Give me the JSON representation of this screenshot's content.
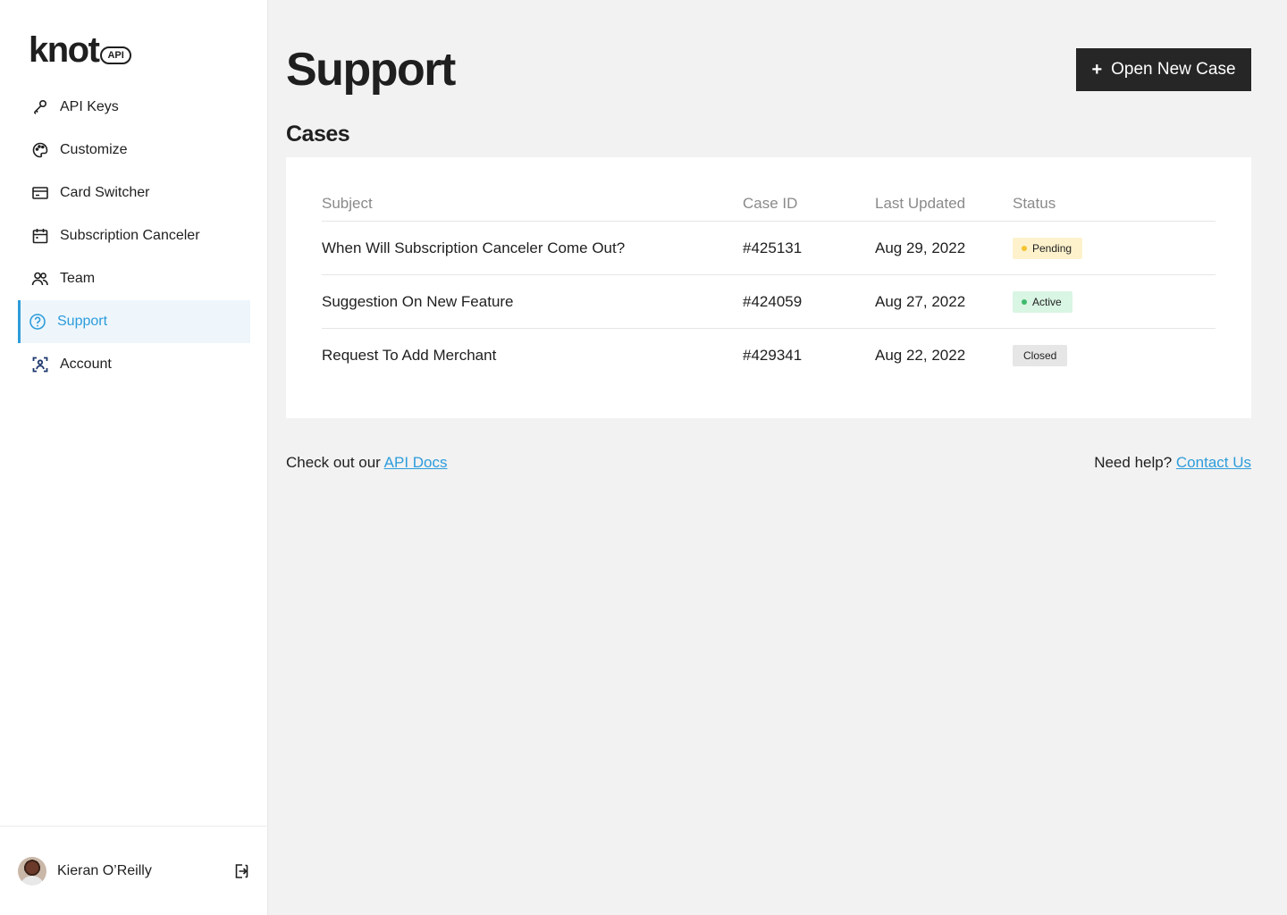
{
  "logo": {
    "word": "knot",
    "badge": "API"
  },
  "nav": [
    {
      "label": "API Keys",
      "icon": "key-icon",
      "active": false
    },
    {
      "label": "Customize",
      "icon": "palette-icon",
      "active": false
    },
    {
      "label": "Card Switcher",
      "icon": "credit-card-icon",
      "active": false
    },
    {
      "label": "Subscription Canceler",
      "icon": "calendar-icon",
      "active": false
    },
    {
      "label": "Team",
      "icon": "team-icon",
      "active": false
    },
    {
      "label": "Support",
      "icon": "help-circle-icon",
      "active": true
    },
    {
      "label": "Account",
      "icon": "account-scan-icon",
      "active": false
    }
  ],
  "user": {
    "name": "Kieran O’Reilly"
  },
  "page": {
    "title": "Support",
    "new_case_label": "Open New Case",
    "section_title": "Cases"
  },
  "table": {
    "headers": {
      "subject": "Subject",
      "case_id": "Case ID",
      "updated": "Last Updated",
      "status": "Status"
    },
    "rows": [
      {
        "subject": "When Will Subscription Canceler Come Out?",
        "case_id": "#425131",
        "updated": "Aug 29, 2022",
        "status": "Pending"
      },
      {
        "subject": "Suggestion On New Feature",
        "case_id": "#424059",
        "updated": "Aug 27, 2022",
        "status": "Active"
      },
      {
        "subject": "Request To Add Merchant",
        "case_id": "#429341",
        "updated": "Aug 22, 2022",
        "status": "Closed"
      }
    ]
  },
  "footer": {
    "docs_prefix": "Check out our",
    "docs_link": "API Docs",
    "help_prefix": "Need help?",
    "help_link": "Contact Us"
  },
  "colors": {
    "accent": "#2d9cdb",
    "button": "#262626",
    "pending": "#fdf2cc",
    "active": "#d9f5e3",
    "closed": "#e6e6e6"
  }
}
